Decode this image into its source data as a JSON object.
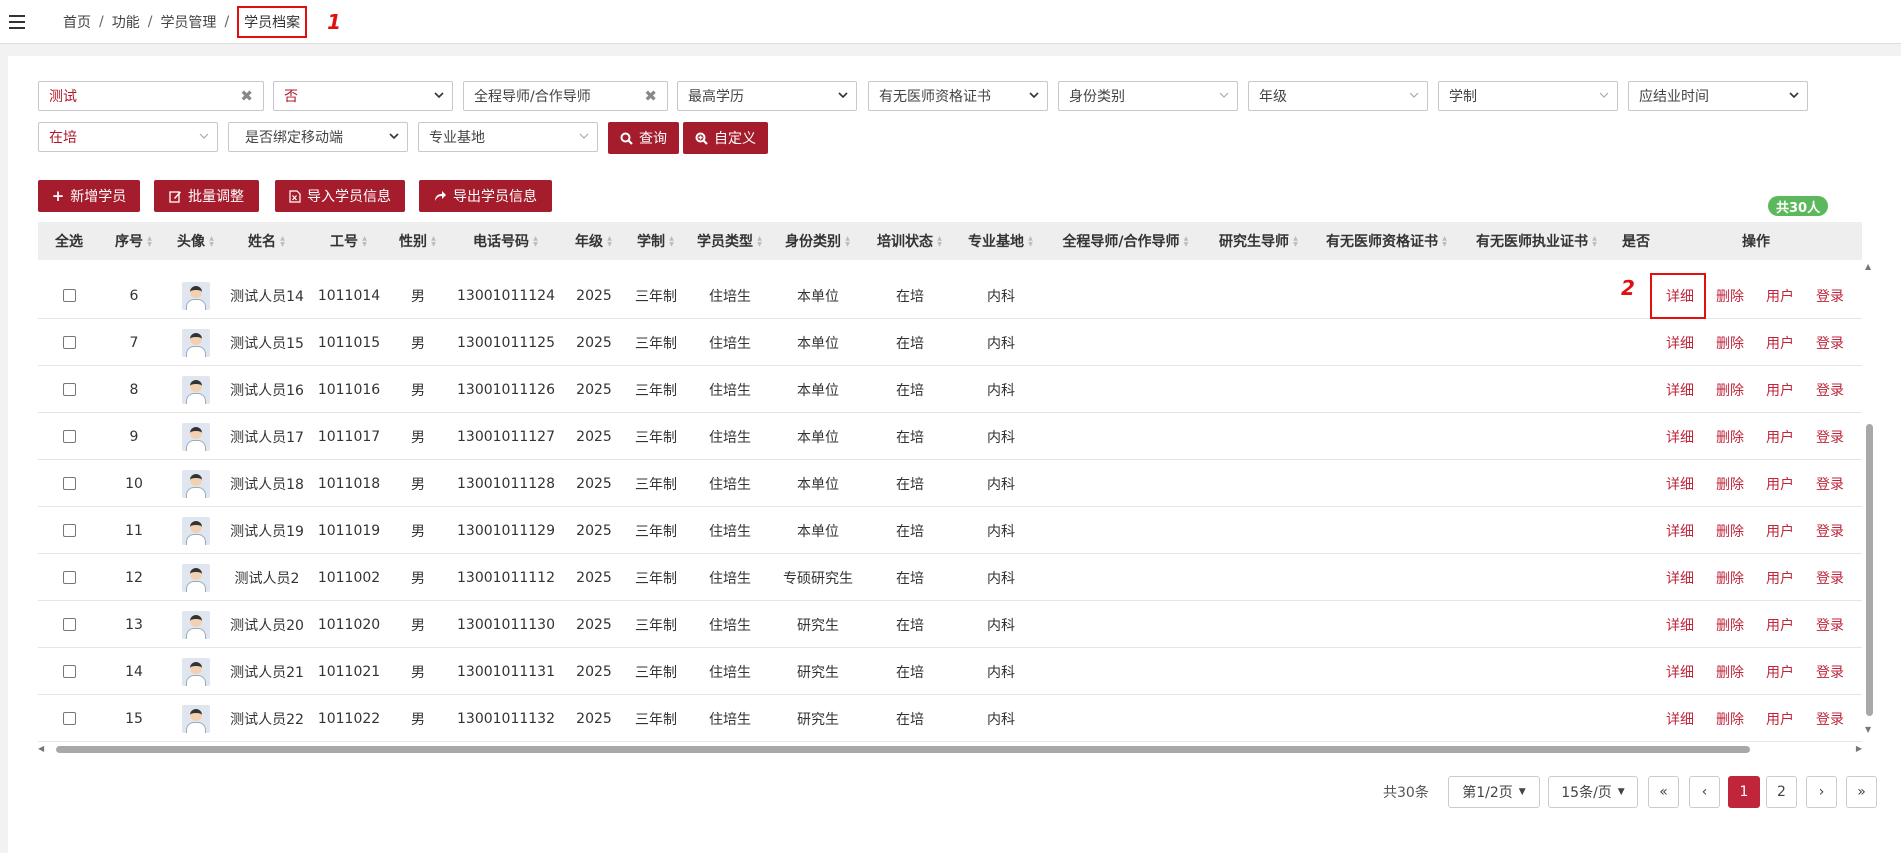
{
  "breadcrumb": {
    "items": [
      "首页",
      "功能",
      "学员管理"
    ],
    "active": "学员档案",
    "marker": "1"
  },
  "filters": {
    "name": "测试",
    "bound_select": "否",
    "tutor": "全程导师/合作导师",
    "education": "最高学历",
    "physician_cert": "有无医师资格证书",
    "identity": "身份类别",
    "grade": "年级",
    "duration": "学制",
    "graduation": "应结业时间",
    "status": "在培",
    "mobile_bound": "是否绑定移动端",
    "base": "专业基地"
  },
  "buttons": {
    "query": "查询",
    "custom": "自定义",
    "add": "新增学员",
    "batch": "批量调整",
    "import": "导入学员信息",
    "export": "导出学员信息"
  },
  "total_badge": "共30人",
  "columns": [
    "全选",
    "序号",
    "头像",
    "姓名",
    "工号",
    "性别",
    "电话号码",
    "年级",
    "学制",
    "学员类型",
    "身份类别",
    "培训状态",
    "专业基地",
    "全程导师/合作导师",
    "研究生导师",
    "有无医师资格证书",
    "有无医师执业证书",
    "是否",
    "操作"
  ],
  "rows": [
    {
      "no": "6",
      "name": "测试人员14",
      "id": "1011014",
      "gender": "男",
      "phone": "13001011124",
      "grade": "2025",
      "duration": "三年制",
      "type": "住培生",
      "identity": "本单位",
      "status": "在培",
      "base": "内科"
    },
    {
      "no": "7",
      "name": "测试人员15",
      "id": "1011015",
      "gender": "男",
      "phone": "13001011125",
      "grade": "2025",
      "duration": "三年制",
      "type": "住培生",
      "identity": "本单位",
      "status": "在培",
      "base": "内科"
    },
    {
      "no": "8",
      "name": "测试人员16",
      "id": "1011016",
      "gender": "男",
      "phone": "13001011126",
      "grade": "2025",
      "duration": "三年制",
      "type": "住培生",
      "identity": "本单位",
      "status": "在培",
      "base": "内科"
    },
    {
      "no": "9",
      "name": "测试人员17",
      "id": "1011017",
      "gender": "男",
      "phone": "13001011127",
      "grade": "2025",
      "duration": "三年制",
      "type": "住培生",
      "identity": "本单位",
      "status": "在培",
      "base": "内科"
    },
    {
      "no": "10",
      "name": "测试人员18",
      "id": "1011018",
      "gender": "男",
      "phone": "13001011128",
      "grade": "2025",
      "duration": "三年制",
      "type": "住培生",
      "identity": "本单位",
      "status": "在培",
      "base": "内科"
    },
    {
      "no": "11",
      "name": "测试人员19",
      "id": "1011019",
      "gender": "男",
      "phone": "13001011129",
      "grade": "2025",
      "duration": "三年制",
      "type": "住培生",
      "identity": "本单位",
      "status": "在培",
      "base": "内科"
    },
    {
      "no": "12",
      "name": "测试人员2",
      "id": "1011002",
      "gender": "男",
      "phone": "13001011112",
      "grade": "2025",
      "duration": "三年制",
      "type": "住培生",
      "identity": "专硕研究生",
      "status": "在培",
      "base": "内科"
    },
    {
      "no": "13",
      "name": "测试人员20",
      "id": "1011020",
      "gender": "男",
      "phone": "13001011130",
      "grade": "2025",
      "duration": "三年制",
      "type": "住培生",
      "identity": "研究生",
      "status": "在培",
      "base": "内科"
    },
    {
      "no": "14",
      "name": "测试人员21",
      "id": "1011021",
      "gender": "男",
      "phone": "13001011131",
      "grade": "2025",
      "duration": "三年制",
      "type": "住培生",
      "identity": "研究生",
      "status": "在培",
      "base": "内科"
    },
    {
      "no": "15",
      "name": "测试人员22",
      "id": "1011022",
      "gender": "男",
      "phone": "13001011132",
      "grade": "2025",
      "duration": "三年制",
      "type": "住培生",
      "identity": "研究生",
      "status": "在培",
      "base": "内科"
    }
  ],
  "actions": [
    "详细",
    "删除",
    "用户",
    "登录"
  ],
  "detail_marker": "2",
  "pagination": {
    "total": "共30条",
    "page": "第1/2页",
    "per_page": "15条/页",
    "first": "«",
    "prev": "‹",
    "p1": "1",
    "p2": "2",
    "next": "›",
    "last": "»"
  },
  "colors": {
    "primary": "#a51d2d",
    "action_text": "#c0263b",
    "badge": "#5cb85c",
    "marker": "#e01010"
  }
}
